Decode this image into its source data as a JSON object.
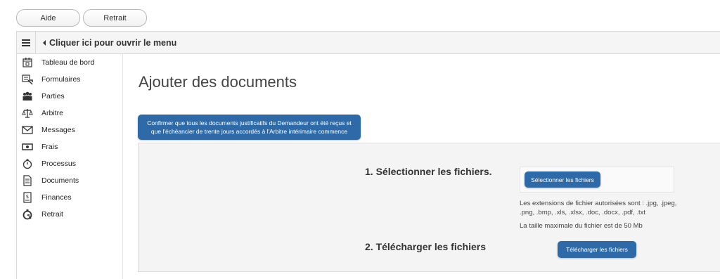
{
  "topbar": {
    "help_label": "Aide",
    "withdraw_label": "Retrait"
  },
  "menubar": {
    "toggle_label": "Cliquer ici pour ouvrir le menu"
  },
  "sidebar": {
    "items": [
      {
        "label": "Tableau de bord",
        "icon": "dashboard-icon"
      },
      {
        "label": "Formulaires",
        "icon": "forms-icon"
      },
      {
        "label": "Parties",
        "icon": "parties-icon"
      },
      {
        "label": "Arbitre",
        "icon": "scales-icon"
      },
      {
        "label": "Messages",
        "icon": "envelope-icon"
      },
      {
        "label": "Frais",
        "icon": "banknote-icon"
      },
      {
        "label": "Processus",
        "icon": "stopwatch-icon"
      },
      {
        "label": "Documents",
        "icon": "document-icon"
      },
      {
        "label": "Finances",
        "icon": "finance-icon"
      },
      {
        "label": "Retrait",
        "icon": "withdraw-icon"
      }
    ]
  },
  "main": {
    "title": "Ajouter des documents",
    "confirm_button": "Confirmer que tous les documents justificatifs du Demandeur ont été reçus et que l'échéancier de trente jours accordés à l'Arbitre intérimaire commence",
    "upload": {
      "step1_label": "1. Sélectionner les fichiers.",
      "select_button": "Sélectionner les fichiers",
      "extensions_text": "Les extensions de fichier autorisées sont : .jpg, .jpeg, .png, .bmp, .xls, .xlsx, .doc, .docx, .pdf, .txt",
      "max_size_text": "La taille maximale du fichier est de 50 Mb",
      "step2_label": "2. Télécharger les fichiers",
      "upload_button": "Télécharger les fichiers"
    }
  },
  "colors": {
    "primary_button": "#2f6aa8",
    "panel_bg": "#f4f4f4"
  }
}
